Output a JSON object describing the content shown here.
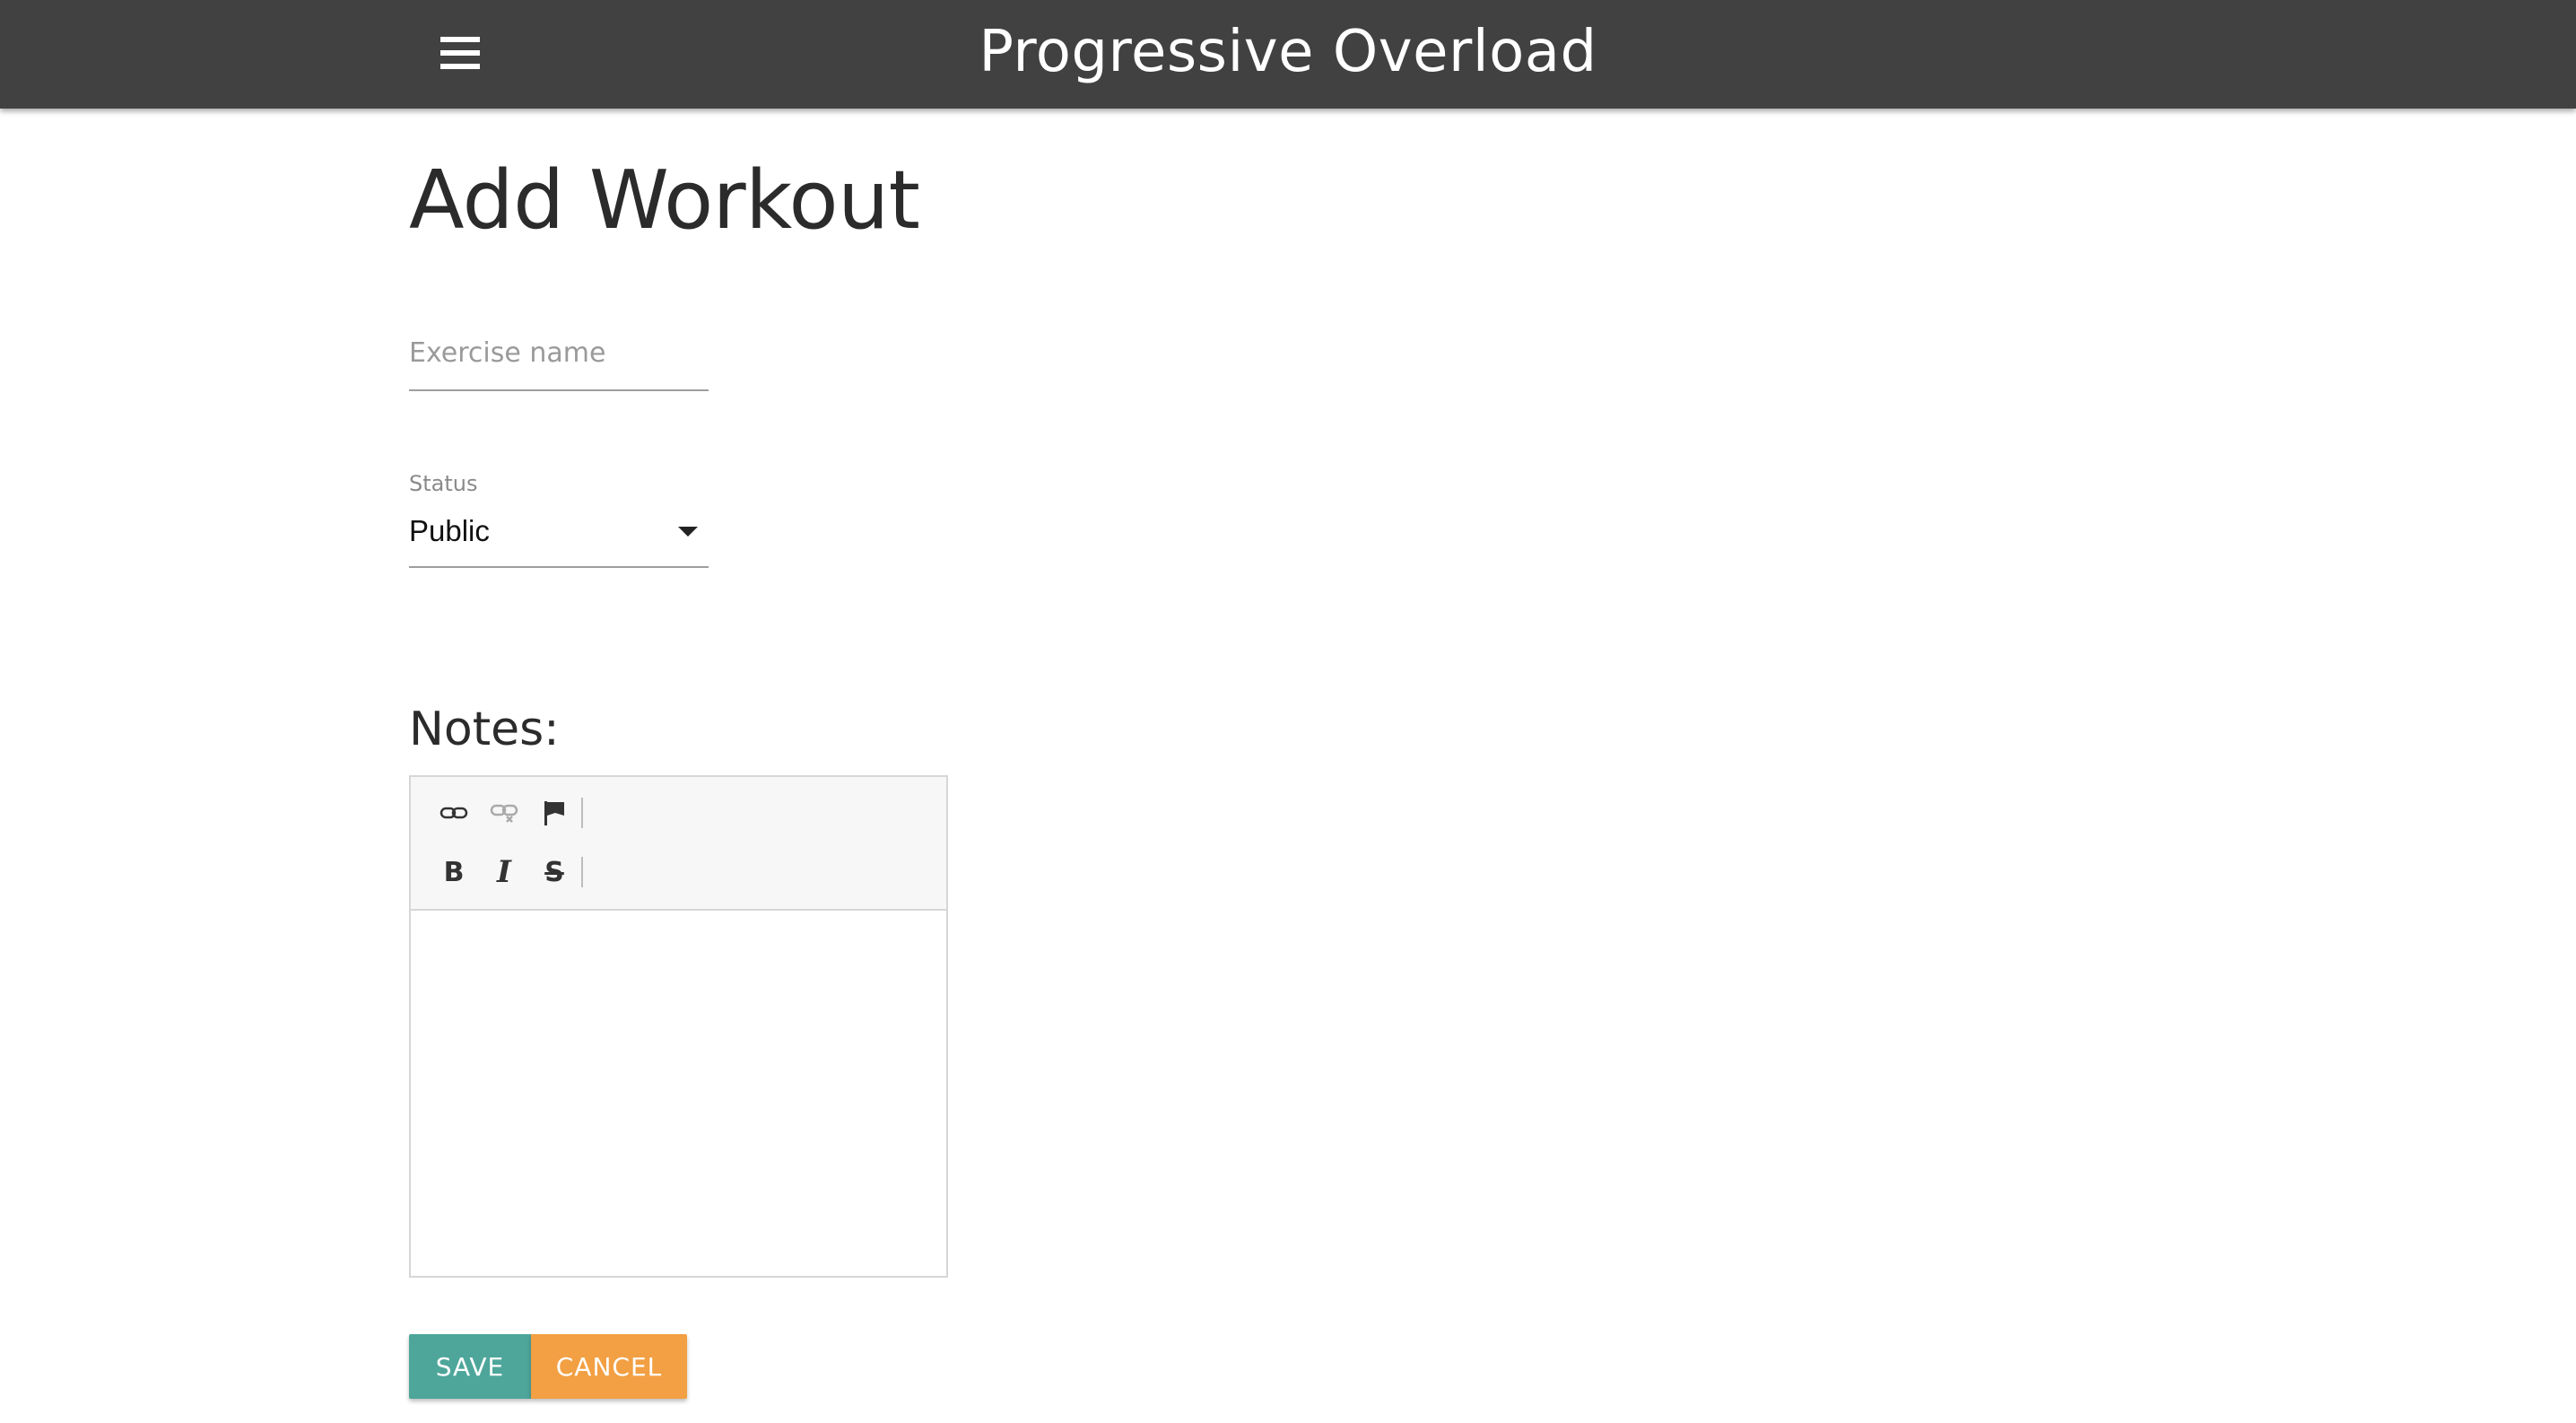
{
  "appbar": {
    "title": "Progressive Overload",
    "menu_icon": "hamburger-menu-icon",
    "background": "#414141"
  },
  "page": {
    "title": "Add Workout"
  },
  "form": {
    "exercise": {
      "placeholder": "Exercise name",
      "value": ""
    },
    "status": {
      "label": "Status",
      "selected": "Public"
    },
    "notes": {
      "label": "Notes:",
      "toolbar": {
        "row1": [
          "link-icon",
          "unlink-icon",
          "flag-icon"
        ],
        "row2": {
          "bold": "B",
          "italic": "I",
          "strikethrough": "S"
        }
      },
      "content": ""
    }
  },
  "actions": {
    "save_label": "SAVE",
    "cancel_label": "CANCEL",
    "save_color": "#4ea69a",
    "cancel_color": "#f2a043"
  }
}
